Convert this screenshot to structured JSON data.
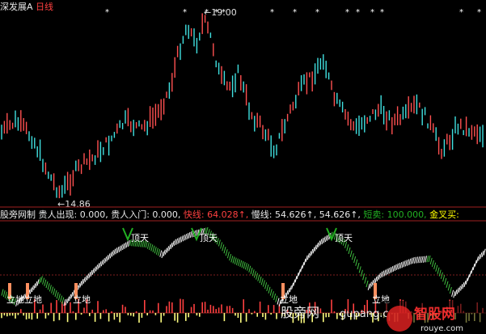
{
  "header": {
    "stock_name": "深发展A",
    "timeframe": "日线"
  },
  "main_chart": {
    "high_label": "19.00",
    "low_label": "14.86",
    "arrow_glyph": "←"
  },
  "indicator": {
    "name": "股旁网制",
    "fields": [
      {
        "label": "贵人出现",
        "value": "0.000",
        "color": "#e8e8e8"
      },
      {
        "label": "贵人入门",
        "value": "0.000",
        "color": "#e8e8e8"
      },
      {
        "label": "快线",
        "value": "64.028↑",
        "color": "#ff4040"
      },
      {
        "label": "慢线",
        "value": "54.626↑",
        "color": "#e8e8e8"
      },
      {
        "label": "",
        "value": "54.626↑",
        "color": "#e8e8e8"
      },
      {
        "label": "短卖",
        "value": "100.000",
        "color": "#22b022"
      },
      {
        "label": "金叉买",
        "value": "",
        "color": "#ffff00"
      }
    ],
    "top_labels": [
      "顶天",
      "顶天",
      "顶天"
    ],
    "bottom_labels": [
      "立地",
      "立地",
      "立地",
      "立地",
      "立地"
    ]
  },
  "watermark": {
    "text1": "股旁网",
    "text2": "gupang.com",
    "text3": "智股网",
    "text4": "rouye.com"
  },
  "colors": {
    "up": "#ff5050",
    "down": "#40e0e0",
    "neutral": "#e0e0e0",
    "separator": "#a02020",
    "fast_line": "#ffffff",
    "slow_line": "#40c040",
    "histogram_up": "#ff4040",
    "histogram_down": "#ffff80",
    "signal_bar": "#ff9060"
  }
}
